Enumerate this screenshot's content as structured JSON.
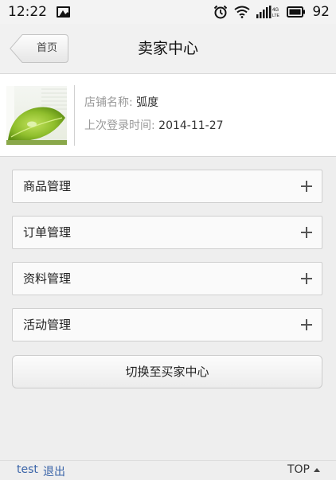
{
  "status_bar": {
    "time": "12:22",
    "network": "4G",
    "battery": "92"
  },
  "header": {
    "back_label": "首页",
    "title": "卖家中心"
  },
  "shop": {
    "name_label": "店铺名称:",
    "name_value": "弧度",
    "login_label": "上次登录时间:",
    "login_value": "2014-11-27"
  },
  "menu": {
    "items": [
      {
        "label": "商品管理"
      },
      {
        "label": "订单管理"
      },
      {
        "label": "资料管理"
      },
      {
        "label": "活动管理"
      }
    ],
    "switch_label": "切换至买家中心"
  },
  "footer": {
    "user": "test",
    "logout": "退出",
    "top": "TOP"
  },
  "colors": {
    "link": "#3a64a8",
    "leaf_green": "#8fbe2c"
  }
}
